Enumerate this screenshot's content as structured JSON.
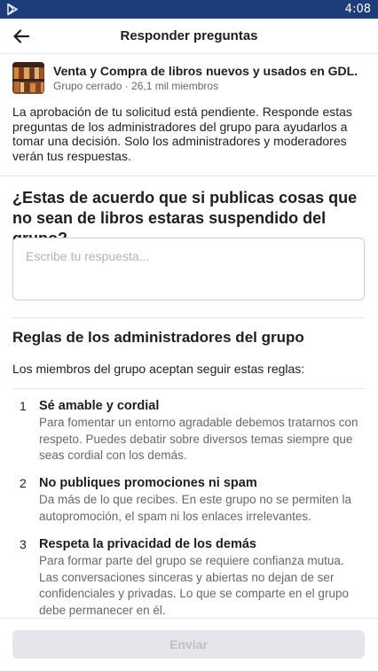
{
  "status_bar": {
    "time": "4:08"
  },
  "app_bar": {
    "title": "Responder preguntas"
  },
  "group": {
    "name": "Venta y Compra de libros nuevos y usados en GDL.",
    "subtitle": "Grupo cerrado · 26,1 mil miembros"
  },
  "notice": "La aprobación de tu solicitud está pendiente. Responde estas preguntas de los administradores del grupo para ayudarlos a tomar una decisión. Solo los administradores y moderadores verán tus respuestas.",
  "question": {
    "text": "¿Estas de acuerdo que si publicas cosas que no sean de libros estaras suspendido del grupo?",
    "answer_placeholder": "Escribe tu respuesta...",
    "answer_value": ""
  },
  "rules": {
    "title": "Reglas de los administradores del grupo",
    "intro": "Los miembros del grupo aceptan seguir estas reglas:",
    "items": [
      {
        "number": "1",
        "title": "Sé amable y cordial",
        "description": "Para fomentar un entorno agradable debemos tratarnos con respeto. Puedes debatir sobre diversos temas siempre que seas cordial con los demás."
      },
      {
        "number": "2",
        "title": "No publiques promociones ni spam",
        "description": "Da más de lo que recibes. En este grupo no se permiten la autopromoción, el spam ni los enlaces irrelevantes."
      },
      {
        "number": "3",
        "title": "Respeta la privacidad de los demás",
        "description": "Para formar parte del grupo se requiere confianza mutua. Las conversaciones sinceras y abiertas no dejan de ser confidenciales y privadas. Lo que se comparte en el grupo debe permanecer en él."
      }
    ]
  },
  "footer": {
    "send_label": "Enviar"
  },
  "colors": {
    "status_bar": "#1d3d7a",
    "text_primary": "#1c1e21",
    "text_secondary": "#65676b",
    "button_disabled_bg": "#e4e6eb",
    "button_disabled_text": "#bcc0c4"
  }
}
